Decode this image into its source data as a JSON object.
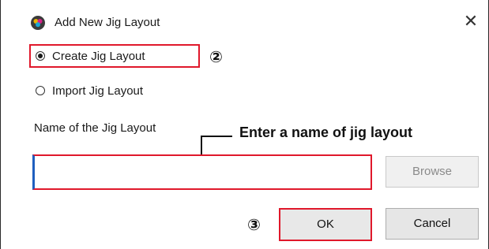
{
  "dialog": {
    "title": "Add New Jig Layout",
    "app_icon": "printer-color-icon",
    "close_glyph": "✕"
  },
  "options": {
    "create_label": "Create Jig Layout",
    "import_label": "Import Jig Layout",
    "selected": "create"
  },
  "form": {
    "name_label": "Name of the Jig Layout",
    "name_value": "",
    "browse_label": "Browse"
  },
  "buttons": {
    "ok_label": "OK",
    "cancel_label": "Cancel"
  },
  "annotations": {
    "step2": "②",
    "step3": "③",
    "name_hint": "Enter a name of jig layout"
  },
  "colors": {
    "highlight": "#e0182b",
    "input_focus": "#1f5fbf"
  }
}
